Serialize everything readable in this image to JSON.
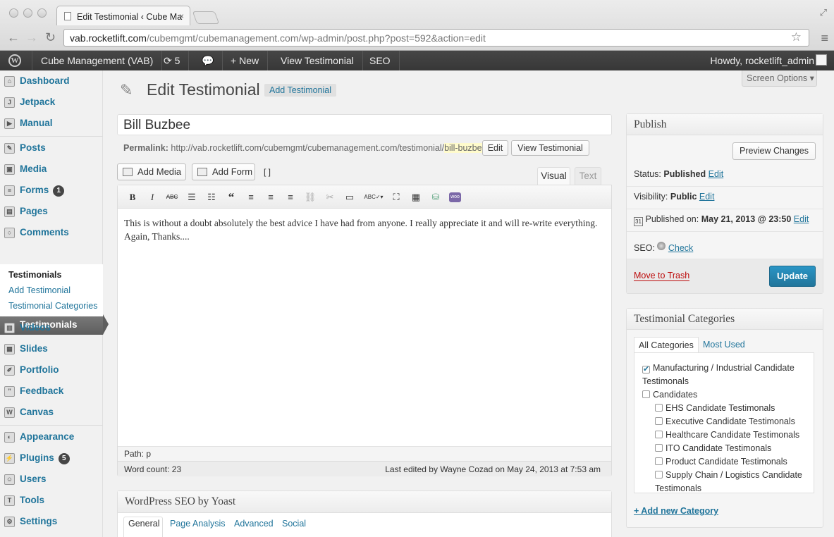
{
  "browser": {
    "tab_title": "Edit Testimonial ‹ Cube Ma",
    "url_host": "vab.rocketlift.com",
    "url_path": "/cubemgmt/cubemanagement.com/wp-admin/post.php?post=592&action=edit"
  },
  "adminbar": {
    "site": "Cube Management (VAB)",
    "updates": "5",
    "new": "New",
    "view": "View Testimonial",
    "seo": "SEO",
    "howdy": "Howdy, rocketlift_admin"
  },
  "sidebar": {
    "dashboard": "Dashboard",
    "jetpack": "Jetpack",
    "manual": "Manual",
    "posts": "Posts",
    "media": "Media",
    "forms": "Forms",
    "forms_badge": "1",
    "pages": "Pages",
    "comments": "Comments",
    "testimonials": "Testimonials",
    "sub_testimonials": "Testimonials",
    "sub_add": "Add Testimonial",
    "sub_cats": "Testimonial Categories",
    "videos": "Videos",
    "slides": "Slides",
    "portfolio": "Portfolio",
    "feedback": "Feedback",
    "canvas": "Canvas",
    "appearance": "Appearance",
    "plugins": "Plugins",
    "plugins_badge": "5",
    "users": "Users",
    "tools": "Tools",
    "settings": "Settings"
  },
  "page": {
    "title": "Edit Testimonial",
    "add_new": "Add Testimonial",
    "screen_options": "Screen Options ▾"
  },
  "post": {
    "title": "Bill Buzbee",
    "permalink_label": "Permalink:",
    "permalink_base": "http://vab.rocketlift.com/cubemgmt/cubemanagement.com/testimonial/",
    "permalink_slug": "bill-buzbee",
    "permalink_end": "/",
    "edit_btn": "Edit",
    "view_btn": "View Testimonial"
  },
  "editor": {
    "add_media": "Add Media",
    "add_form": "Add Form",
    "shortcode": "[ ]",
    "tab_visual": "Visual",
    "tab_text": "Text",
    "content": "This is without a doubt absolutely the best advice I have had from anyone. I really appreciate it and will re-write everything. Again, Thanks....",
    "path": "Path: p",
    "word_count": "Word count: 23",
    "last_edited": "Last edited by Wayne Cozad on May 24, 2013 at 7:53 am"
  },
  "seo_box": {
    "title": "WordPress SEO by Yoast",
    "tabs": [
      "General",
      "Page Analysis",
      "Advanced",
      "Social"
    ]
  },
  "publish": {
    "title": "Publish",
    "preview": "Preview Changes",
    "status_label": "Status:",
    "status_value": "Published",
    "visibility_label": "Visibility:",
    "visibility_value": "Public",
    "published_label": "Published on:",
    "published_value": "May 21, 2013 @ 23:50",
    "edit": "Edit",
    "seo_label": "SEO:",
    "seo_check": "Check",
    "trash": "Move to Trash",
    "update": "Update"
  },
  "categories": {
    "title": "Testimonial Categories",
    "tab_all": "All Categories",
    "tab_used": "Most Used",
    "items": [
      {
        "label": "Manufacturing / Industrial Candidate",
        "label2": "Testimonals",
        "checked": true
      },
      {
        "label": "Candidates",
        "checked": false
      },
      {
        "label": "EHS Candidate Testimonals",
        "checked": false
      },
      {
        "label": "Executive Candidate Testimonals",
        "checked": false
      },
      {
        "label": "Healthcare Candidate Testimonals",
        "checked": false
      },
      {
        "label": "ITO Candidate Testimonals",
        "checked": false
      },
      {
        "label": "Product Candidate Testimonals",
        "checked": false
      },
      {
        "label": "Supply Chain / Logistics Candidate",
        "label2": "Testimonals",
        "checked": false
      }
    ],
    "add_new": "+ Add new Category"
  }
}
